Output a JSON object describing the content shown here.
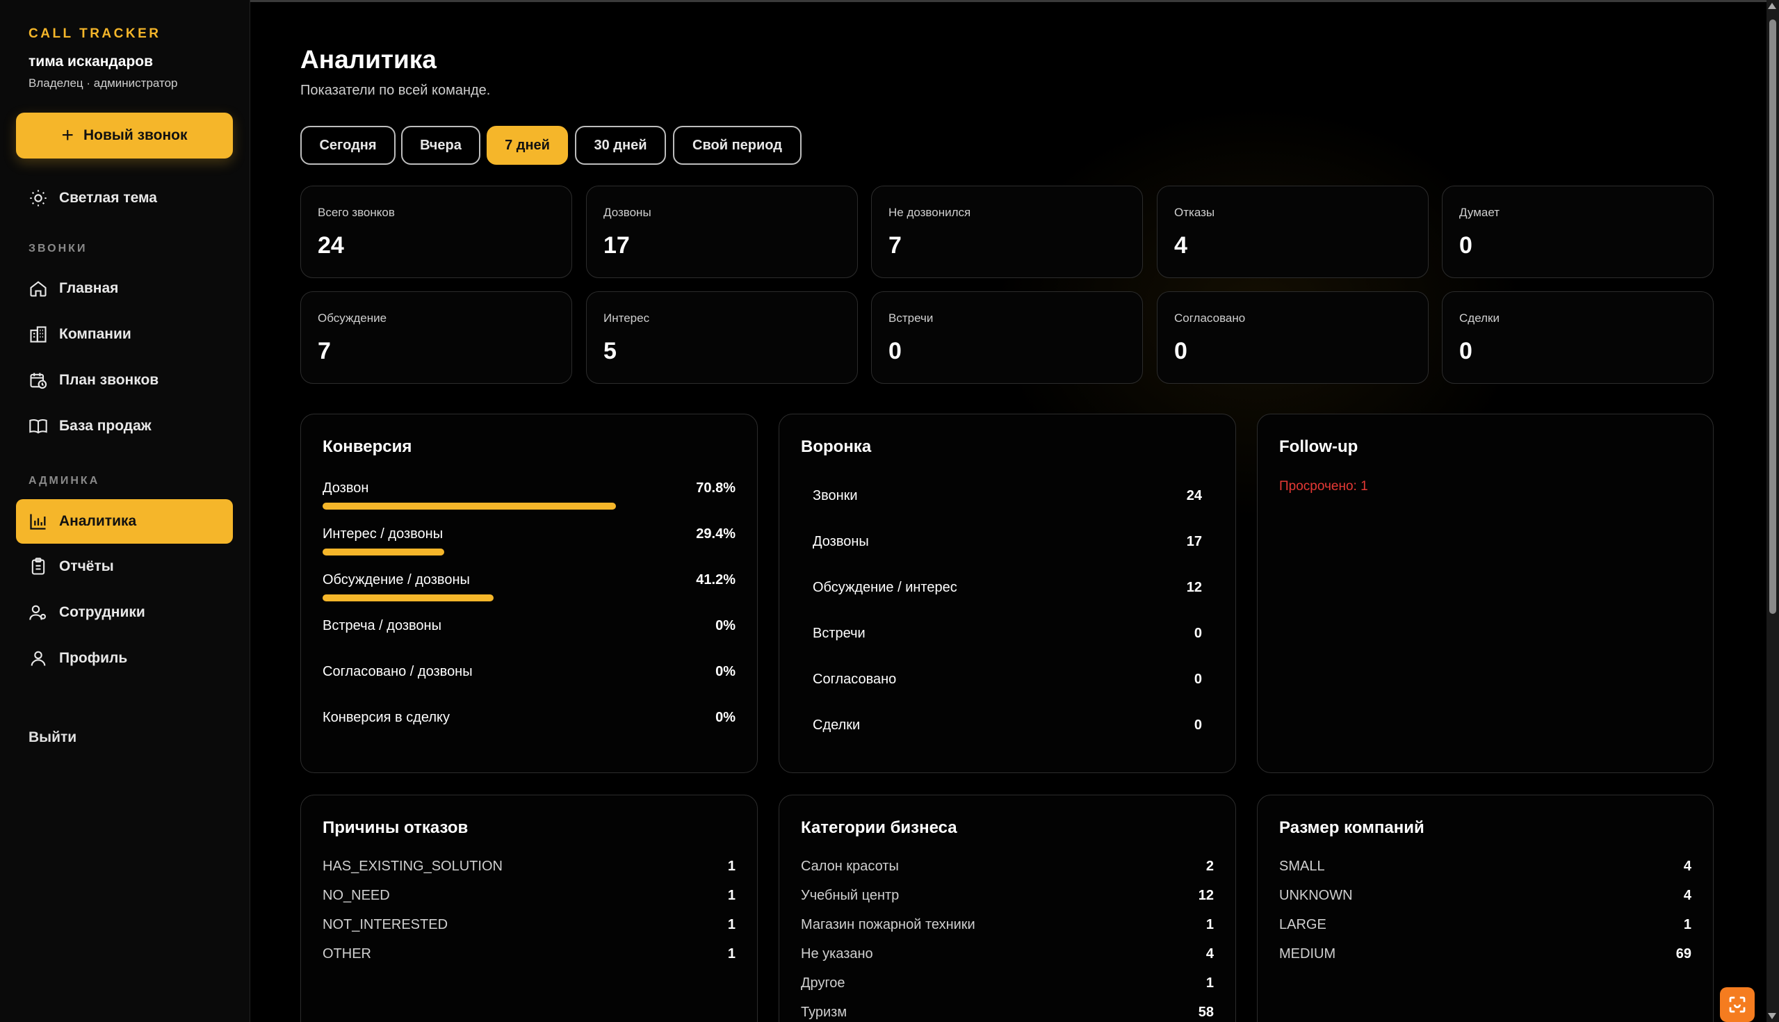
{
  "brand": "CALL TRACKER",
  "user": {
    "name": "тима искандаров",
    "role": "Владелец · администратор"
  },
  "new_call_label": "Новый звонок",
  "theme_toggle_label": "Светлая тема",
  "sections": {
    "calls": "ЗВОНКИ",
    "admin": "АДМИНКА"
  },
  "nav": {
    "home": "Главная",
    "companies": "Компании",
    "call_plan": "План звонков",
    "sales_base": "База продаж",
    "analytics": "Аналитика",
    "reports": "Отчёты",
    "employees": "Сотрудники",
    "profile": "Профиль"
  },
  "logout_label": "Выйти",
  "page": {
    "title": "Аналитика",
    "subtitle": "Показатели по всей команде."
  },
  "periods": [
    "Сегодня",
    "Вчера",
    "7 дней",
    "30 дней",
    "Свой период"
  ],
  "active_period": "7 дней",
  "stats": [
    {
      "label": "Всего звонков",
      "value": "24"
    },
    {
      "label": "Дозвоны",
      "value": "17"
    },
    {
      "label": "Не дозвонился",
      "value": "7"
    },
    {
      "label": "Отказы",
      "value": "4"
    },
    {
      "label": "Думает",
      "value": "0"
    },
    {
      "label": "Обсуждение",
      "value": "7"
    },
    {
      "label": "Интерес",
      "value": "5"
    },
    {
      "label": "Встречи",
      "value": "0"
    },
    {
      "label": "Согласовано",
      "value": "0"
    },
    {
      "label": "Сделки",
      "value": "0"
    }
  ],
  "conversion": {
    "title": "Конверсия",
    "rows": [
      {
        "label": "Дозвон",
        "percent": "70.8%",
        "fraction": 0.708
      },
      {
        "label": "Интерес / дозвоны",
        "percent": "29.4%",
        "fraction": 0.294
      },
      {
        "label": "Обсуждение / дозвоны",
        "percent": "41.2%",
        "fraction": 0.412
      },
      {
        "label": "Встреча / дозвоны",
        "percent": "0%",
        "fraction": 0
      },
      {
        "label": "Согласовано / дозвоны",
        "percent": "0%",
        "fraction": 0
      },
      {
        "label": "Конверсия в сделку",
        "percent": "0%",
        "fraction": 0
      }
    ]
  },
  "funnel": {
    "title": "Воронка",
    "rows": [
      {
        "label": "Звонки",
        "value": "24"
      },
      {
        "label": "Дозвоны",
        "value": "17"
      },
      {
        "label": "Обсуждение / интерес",
        "value": "12"
      },
      {
        "label": "Встречи",
        "value": "0"
      },
      {
        "label": "Согласовано",
        "value": "0"
      },
      {
        "label": "Сделки",
        "value": "0"
      }
    ]
  },
  "followup": {
    "title": "Follow-up",
    "overdue": "Просрочено: 1"
  },
  "refusals": {
    "title": "Причины отказов",
    "rows": [
      {
        "label": "HAS_EXISTING_SOLUTION",
        "value": "1"
      },
      {
        "label": "NO_NEED",
        "value": "1"
      },
      {
        "label": "NOT_INTERESTED",
        "value": "1"
      },
      {
        "label": "OTHER",
        "value": "1"
      }
    ]
  },
  "categories": {
    "title": "Категории бизнеса",
    "rows": [
      {
        "label": "Салон красоты",
        "value": "2"
      },
      {
        "label": "Учебный центр",
        "value": "12"
      },
      {
        "label": "Магазин пожарной техники",
        "value": "1"
      },
      {
        "label": "Не указано",
        "value": "4"
      },
      {
        "label": "Другое",
        "value": "1"
      },
      {
        "label": "Туризм",
        "value": "58"
      }
    ]
  },
  "company_size": {
    "title": "Размер компаний",
    "rows": [
      {
        "label": "SMALL",
        "value": "4"
      },
      {
        "label": "UNKNOWN",
        "value": "4"
      },
      {
        "label": "LARGE",
        "value": "1"
      },
      {
        "label": "MEDIUM",
        "value": "69"
      }
    ]
  },
  "colors": {
    "accent": "#f5b62a",
    "danger": "#e53935",
    "background": "#000000"
  }
}
